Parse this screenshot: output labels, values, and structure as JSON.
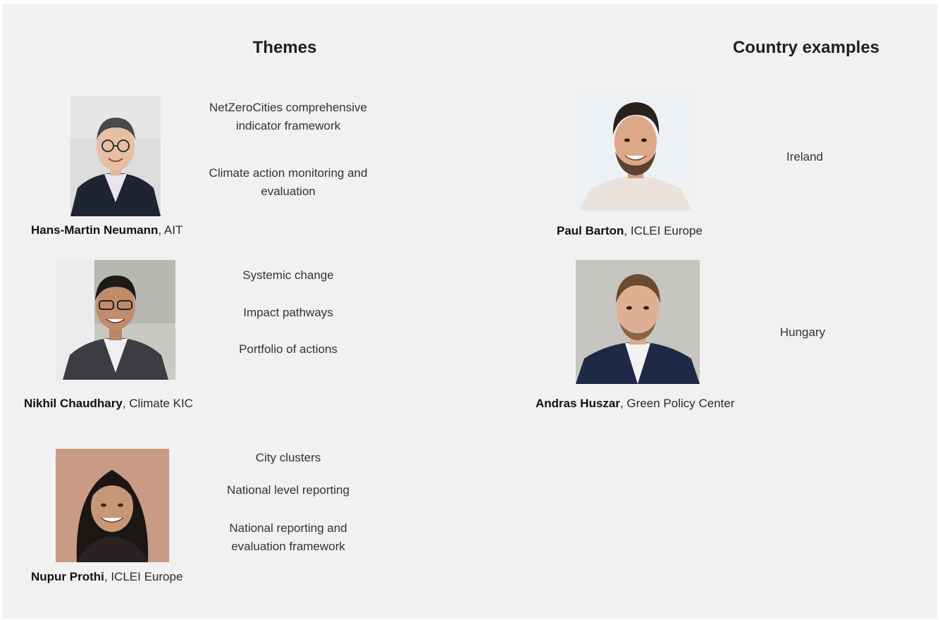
{
  "headings": {
    "themes": "Themes",
    "countries": "Country examples"
  },
  "speakers": [
    {
      "name": "Hans-Martin Neumann",
      "org": ", AIT",
      "topics": [
        "NetZeroCities comprehensive indicator framework",
        "Climate action monitoring and evaluation"
      ]
    },
    {
      "name": "Nikhil Chaudhary",
      "org": ", Climate KIC",
      "topics": [
        "Systemic change",
        "Impact pathways",
        "Portfolio of actions"
      ]
    },
    {
      "name": "Nupur Prothi",
      "org": ", ICLEI Europe",
      "topics": [
        "City clusters",
        "National level reporting",
        "National reporting and evaluation framework"
      ]
    }
  ],
  "country_speakers": [
    {
      "name": "Paul Barton",
      "org": ", ICLEI Europe",
      "country": "Ireland"
    },
    {
      "name": "Andras Huszar",
      "org": ", Green Policy Center",
      "country": "Hungary"
    }
  ],
  "photo_icons": [
    "person-photo-icon"
  ]
}
